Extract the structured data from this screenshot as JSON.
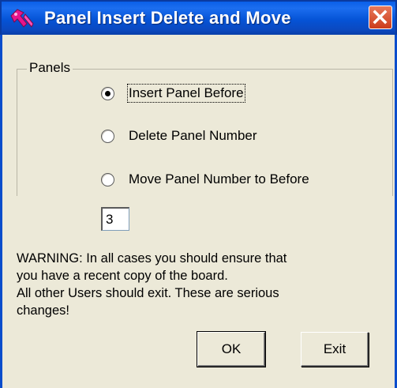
{
  "window": {
    "title": "Panel Insert Delete and Move",
    "app_icon": "pink-hammer-icon",
    "close_icon": "close-x-icon"
  },
  "group": {
    "label": "Panels",
    "options": [
      {
        "label": "Insert Panel Before",
        "checked": true
      },
      {
        "label": "Delete Panel Number",
        "checked": false
      },
      {
        "label": "Move Panel Number to Before",
        "checked": false
      }
    ],
    "number_value": "3"
  },
  "warning": {
    "lines": [
      "WARNING: In all cases you should ensure that",
      "you have a recent copy of the board.",
      "All other Users should exit. These are serious",
      "changes!"
    ]
  },
  "buttons": {
    "ok_label": "OK",
    "exit_label": "Exit"
  },
  "colors": {
    "titlebar": "#0553d6",
    "dialog_bg": "#ece9d8",
    "close_button": "#d7502f",
    "app_icon": "#e8148c"
  }
}
